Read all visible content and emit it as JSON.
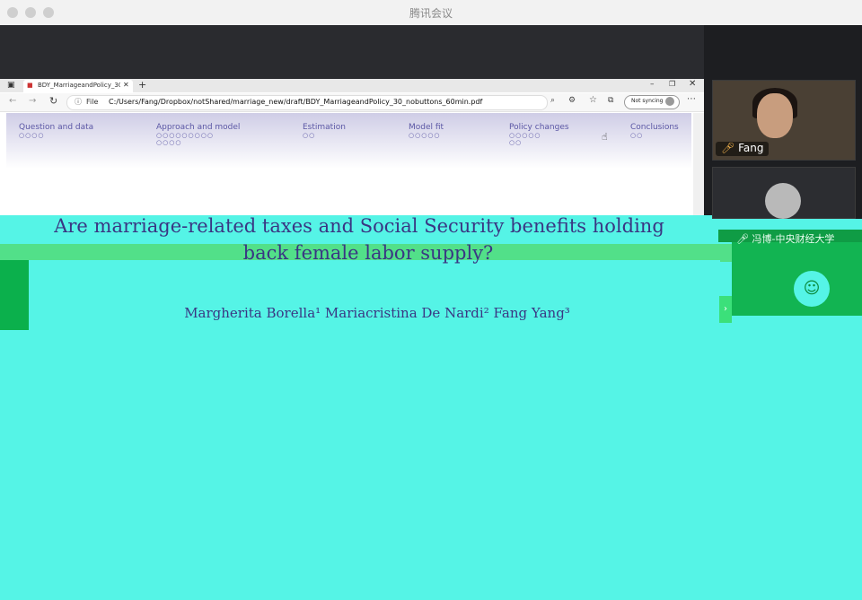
{
  "app": {
    "title": "腾讯会议"
  },
  "browser": {
    "tab_title": "BDY_MarriageandPolicy_30_nob...",
    "file_label": "File",
    "url": "C:/Users/Fang/Dropbox/notShared/marriage_new/draft/BDY_MarriageandPolicy_30_nobuttons_60min.pdf",
    "sync_label": "Not syncing"
  },
  "slide": {
    "nav": [
      {
        "label": "Question and data",
        "dots": "○○○○"
      },
      {
        "label": "Approach and model",
        "dots": "○○○○○○○○○\n○○○○"
      },
      {
        "label": "Estimation",
        "dots": "○○"
      },
      {
        "label": "Model fit",
        "dots": "○○○○○"
      },
      {
        "label": "Policy changes",
        "dots": "○○○○○\n○○"
      },
      {
        "label": "Conclusions",
        "dots": "○○"
      }
    ],
    "title_line1": "Are marriage-related taxes and Social Security benefits holding",
    "title_line2": "back female labor supply?",
    "authors": "Margherita Borella¹   Mariacristina De Nardi²   Fang Yang³"
  },
  "participants": {
    "speaker_name": "Fang",
    "user2_name": "冯博-中央财经大学"
  },
  "colors": {
    "slide_text": "#3a3683",
    "nav_text": "#5b57a5"
  }
}
